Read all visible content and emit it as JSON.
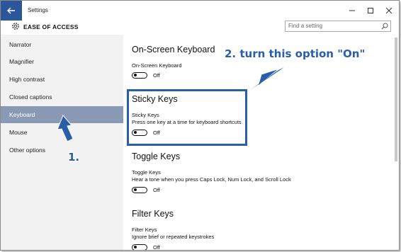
{
  "window": {
    "title": "Settings"
  },
  "header": {
    "section": "EASE OF ACCESS",
    "search_placeholder": "Find a setting"
  },
  "sidebar": {
    "items": [
      {
        "label": "Narrator"
      },
      {
        "label": "Magnifier"
      },
      {
        "label": "High contrast"
      },
      {
        "label": "Closed captions"
      },
      {
        "label": "Keyboard",
        "active": true
      },
      {
        "label": "Mouse"
      },
      {
        "label": "Other options"
      }
    ]
  },
  "sections": [
    {
      "heading": "On-Screen Keyboard",
      "setting": "On-Screen Keyboard",
      "desc": "",
      "state": "Off"
    },
    {
      "heading": "Sticky Keys",
      "setting": "Sticky Keys",
      "desc": "Press one key at a time for keyboard shortcuts",
      "state": "Off"
    },
    {
      "heading": "Toggle Keys",
      "setting": "Toggle Keys",
      "desc": "Hear a tone when you press Caps Lock, Num Lock, and Scroll Lock",
      "state": "Off"
    },
    {
      "heading": "Filter Keys",
      "setting": "Filter Keys",
      "desc": "Ignore brief or repeated keystrokes",
      "state": "Off"
    }
  ],
  "annotations": {
    "step1": "1.",
    "step2": "2. turn this option \"On\""
  },
  "colors": {
    "accent": "#2b579a",
    "annotation": "#2a5ea8",
    "active_nav": "#8a9ab5"
  }
}
